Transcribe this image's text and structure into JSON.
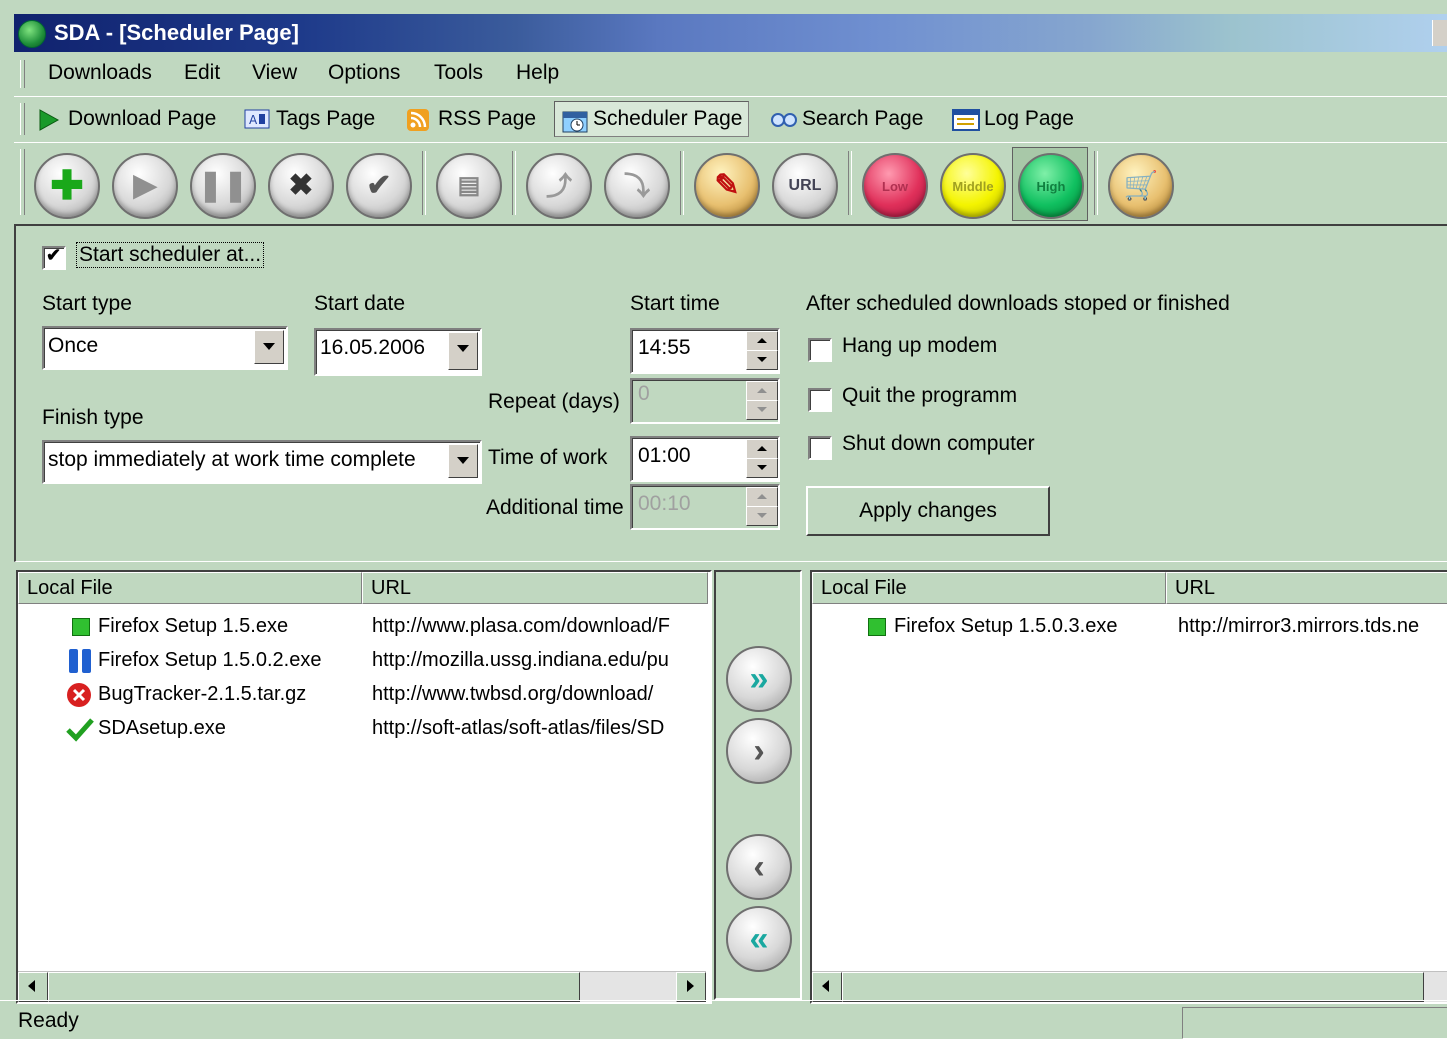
{
  "window": {
    "title": "SDA - [Scheduler Page]"
  },
  "menu": [
    "Downloads",
    "Edit",
    "View",
    "Options",
    "Tools",
    "Help"
  ],
  "page_tabs": [
    {
      "label": "Download Page",
      "icon": "play-arrow-icon"
    },
    {
      "label": "Tags Page",
      "icon": "tags-icon"
    },
    {
      "label": "RSS Page",
      "icon": "rss-icon"
    },
    {
      "label": "Scheduler Page",
      "icon": "scheduler-icon",
      "active": true
    },
    {
      "label": "Search Page",
      "icon": "search-icon"
    },
    {
      "label": "Log Page",
      "icon": "log-icon"
    }
  ],
  "toolbar": {
    "buttons": [
      "add",
      "start",
      "pause",
      "delete",
      "check",
      "settings",
      "upload",
      "download",
      "tools",
      "url",
      "low",
      "middle",
      "high",
      "cart"
    ],
    "priority_labels": {
      "low": "Low",
      "middle": "Middle",
      "high": "High"
    },
    "url_label": "URL"
  },
  "scheduler": {
    "start_checkbox_label": "Start scheduler at...",
    "start_checked": true,
    "start_type_label": "Start type",
    "start_type_value": "Once",
    "start_date_label": "Start date",
    "start_date_value": "16.05.2006",
    "start_time_label": "Start time",
    "start_time_value": "14:55",
    "repeat_label": "Repeat (days)",
    "repeat_value": "0",
    "finish_type_label": "Finish type",
    "finish_type_value": "stop immediately at work time complete",
    "time_of_work_label": "Time of work",
    "time_of_work_value": "01:00",
    "additional_time_label": "Additional time",
    "additional_time_value": "00:10",
    "after_label": "After scheduled downloads stoped or finished",
    "options": [
      {
        "label": "Hang up modem",
        "checked": false
      },
      {
        "label": "Quit the programm",
        "checked": false
      },
      {
        "label": "Shut down computer",
        "checked": false
      }
    ],
    "apply_label": "Apply changes"
  },
  "left_list": {
    "columns": [
      "Local File",
      "URL"
    ],
    "rows": [
      {
        "file": "Firefox Setup 1.5.exe",
        "url": "http://www.plasa.com/download/F",
        "status": "queued"
      },
      {
        "file": "Firefox Setup 1.5.0.2.exe",
        "url": "http://mozilla.ussg.indiana.edu/pu",
        "status": "paused"
      },
      {
        "file": "BugTracker-2.1.5.tar.gz",
        "url": "http://www.twbsd.org/download/",
        "status": "error"
      },
      {
        "file": "SDAsetup.exe",
        "url": "http://soft-atlas/soft-atlas/files/SD",
        "status": "done"
      }
    ]
  },
  "right_list": {
    "columns": [
      "Local File",
      "URL"
    ],
    "rows": [
      {
        "file": "Firefox Setup 1.5.0.3.exe",
        "url": "http://mirror3.mirrors.tds.ne",
        "status": "queued"
      }
    ]
  },
  "status": {
    "text": "Ready"
  }
}
